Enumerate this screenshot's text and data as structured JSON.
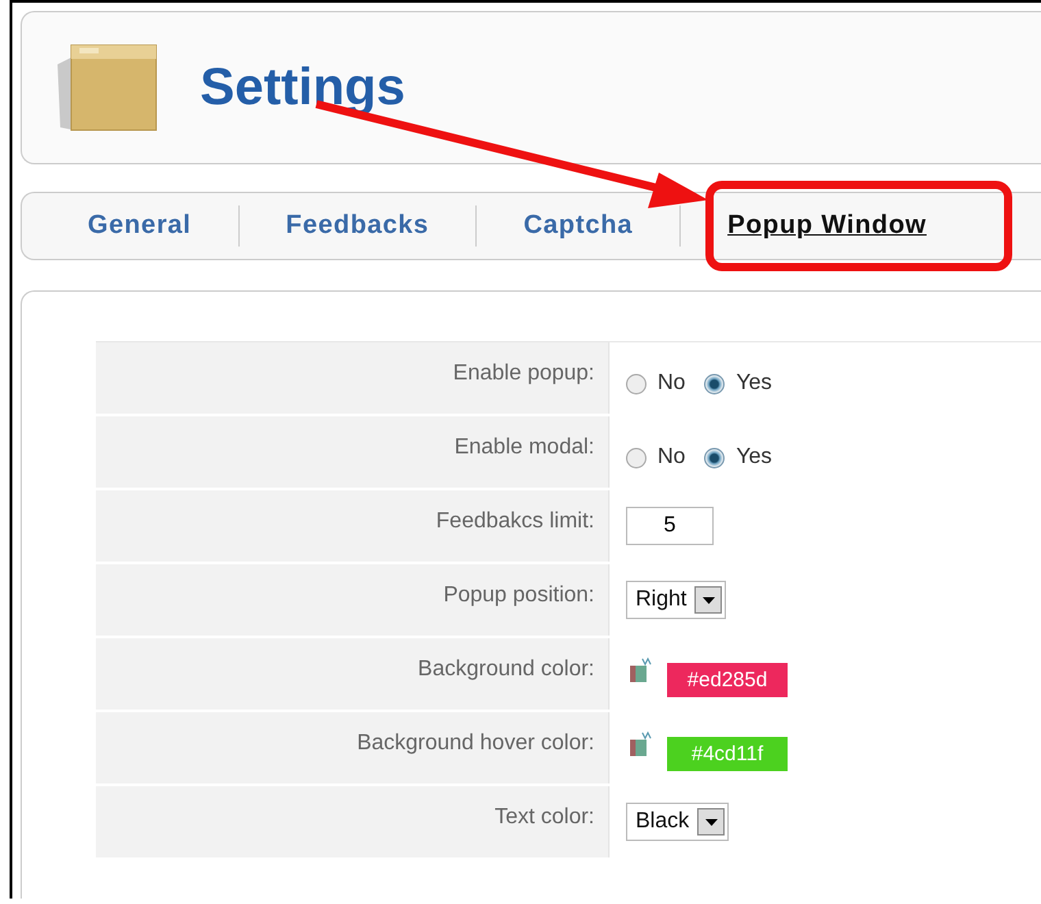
{
  "header": {
    "title": "Settings"
  },
  "tabs": [
    {
      "label": "General",
      "selected": false
    },
    {
      "label": "Feedbacks",
      "selected": false
    },
    {
      "label": "Captcha",
      "selected": false
    },
    {
      "label": "Popup Window",
      "selected": true
    }
  ],
  "form": {
    "rows": [
      {
        "kind": "radio",
        "label": "Enable popup:",
        "options": [
          {
            "label": "No",
            "selected": false
          },
          {
            "label": "Yes",
            "selected": true
          }
        ]
      },
      {
        "kind": "radio",
        "label": "Enable modal:",
        "options": [
          {
            "label": "No",
            "selected": false
          },
          {
            "label": "Yes",
            "selected": true
          }
        ]
      },
      {
        "kind": "text",
        "label": "Feedbakcs limit:",
        "value": "5"
      },
      {
        "kind": "select",
        "label": "Popup position:",
        "value": "Right"
      },
      {
        "kind": "color",
        "label": "Background color:",
        "value": "#ed285d",
        "color": "#ed285d"
      },
      {
        "kind": "color",
        "label": "Background hover color:",
        "value": "#4cd11f",
        "color": "#4cd11f"
      },
      {
        "kind": "select",
        "label": "Text color:",
        "value": "Black"
      }
    ]
  }
}
